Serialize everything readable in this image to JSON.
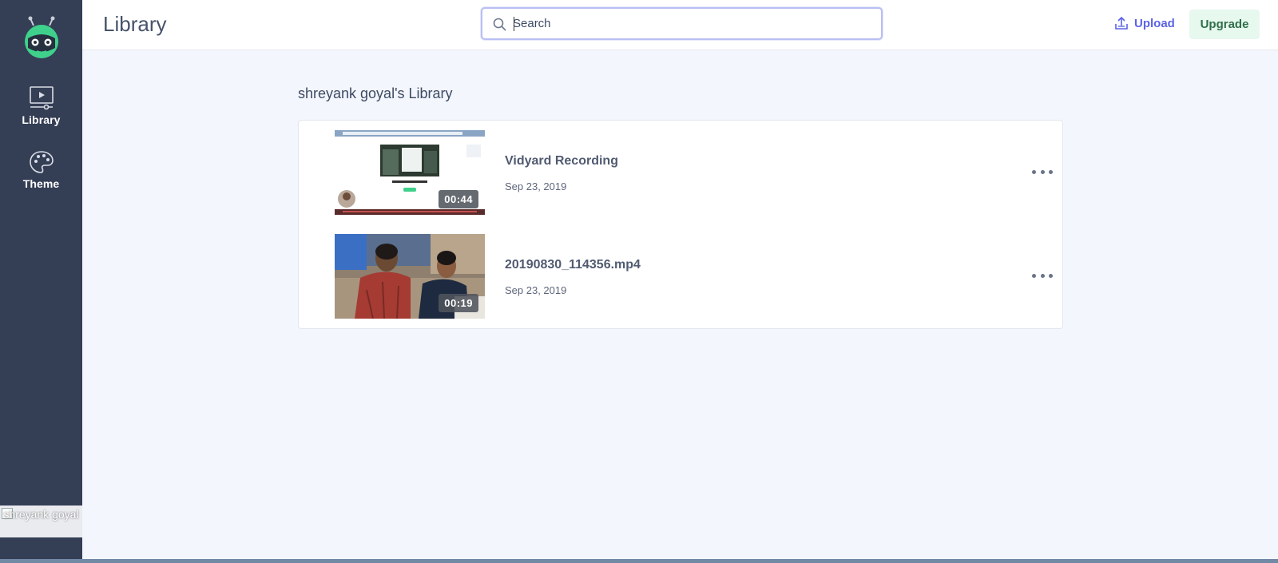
{
  "sidebar": {
    "logo_icon": "robot-logo-icon",
    "items": [
      {
        "label": "Library",
        "icon": "video-library-icon"
      },
      {
        "label": "Theme",
        "icon": "palette-icon"
      }
    ],
    "user": {
      "name": "shreyank goyal"
    }
  },
  "header": {
    "title": "Library",
    "search": {
      "placeholder": "Search",
      "value": ""
    },
    "upload_label": "Upload",
    "upgrade_label": "Upgrade"
  },
  "main": {
    "heading": "shreyank goyal's Library",
    "videos": [
      {
        "title": "Vidyard Recording",
        "date": "Sep 23, 2019",
        "duration": "00:44"
      },
      {
        "title": "20190830_114356.mp4",
        "date": "Sep 23, 2019",
        "duration": "00:19"
      }
    ]
  },
  "colors": {
    "sidebar": "#343e55",
    "accent": "#5b63e6",
    "upgrade_bg": "#e7f8ee",
    "page_bg": "#f3f6fc"
  }
}
